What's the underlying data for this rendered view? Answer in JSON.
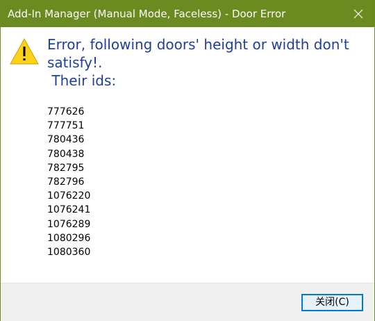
{
  "window": {
    "title": "Add-In Manager (Manual Mode, Faceless) - Door Error",
    "close_glyph": "✕"
  },
  "dialog": {
    "icon": "warning-icon",
    "heading": "Error, following doors' height or width don't\nsatisfy!.\n Their ids:",
    "ids": [
      "777626",
      "777751",
      "780436",
      "780438",
      "782795",
      "782796",
      "1076220",
      "1076241",
      "1076289",
      "1080296",
      "1080360"
    ]
  },
  "buttons": {
    "close_label": "关闭(C)"
  },
  "colors": {
    "titlebar": "#6b8a1f",
    "heading_text": "#1f3f9b",
    "button_border": "#0078d7",
    "warning_fill": "#fcd116"
  }
}
